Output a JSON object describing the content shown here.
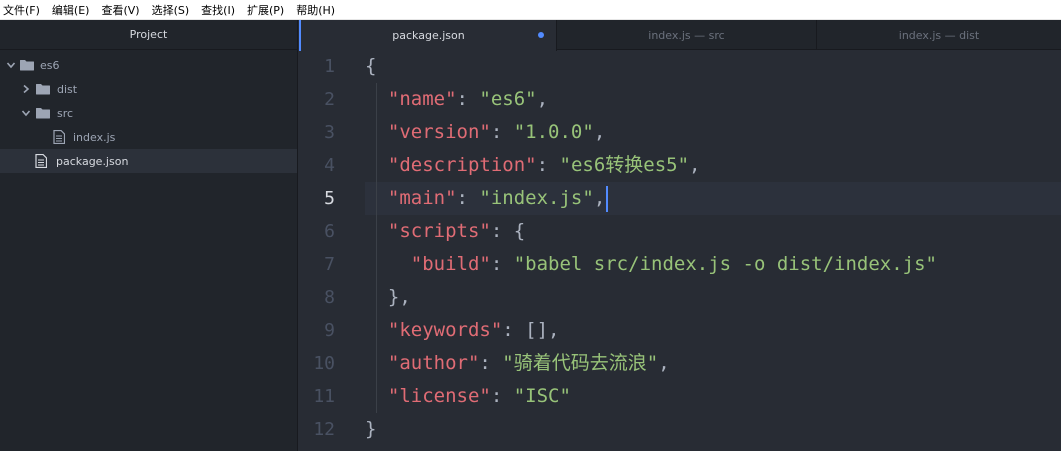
{
  "menubar": {
    "items": [
      {
        "label": "文件(F)"
      },
      {
        "label": "编辑(E)"
      },
      {
        "label": "查看(V)"
      },
      {
        "label": "选择(S)"
      },
      {
        "label": "查找(I)"
      },
      {
        "label": "扩展(P)"
      },
      {
        "label": "帮助(H)"
      }
    ]
  },
  "sidebar": {
    "title": "Project",
    "tree": {
      "root": {
        "label": "es6",
        "icon": "folder-open-icon"
      },
      "dist": {
        "label": "dist",
        "icon": "folder-icon"
      },
      "src": {
        "label": "src",
        "icon": "folder-open-icon"
      },
      "index": {
        "label": "index.js",
        "icon": "file-icon"
      },
      "package": {
        "label": "package.json",
        "icon": "file-icon"
      }
    }
  },
  "tabs": [
    {
      "label": "package.json",
      "active": true,
      "modified": true
    },
    {
      "label": "index.js — src",
      "active": false
    },
    {
      "label": "index.js — dist",
      "active": false
    }
  ],
  "editor": {
    "current_line": 5,
    "line_numbers": [
      "1",
      "2",
      "3",
      "4",
      "5",
      "6",
      "7",
      "8",
      "9",
      "10",
      "11",
      "12"
    ],
    "lines": [
      {
        "tokens": [
          [
            "p",
            "{"
          ]
        ]
      },
      {
        "tokens": [
          [
            "p",
            "  "
          ],
          [
            "k",
            "\"name\""
          ],
          [
            "p",
            ": "
          ],
          [
            "s",
            "\"es6\""
          ],
          [
            "p",
            ","
          ]
        ]
      },
      {
        "tokens": [
          [
            "p",
            "  "
          ],
          [
            "k",
            "\"version\""
          ],
          [
            "p",
            ": "
          ],
          [
            "s",
            "\"1.0.0\""
          ],
          [
            "p",
            ","
          ]
        ]
      },
      {
        "tokens": [
          [
            "p",
            "  "
          ],
          [
            "k",
            "\"description\""
          ],
          [
            "p",
            ": "
          ],
          [
            "s",
            "\"es6转换es5\""
          ],
          [
            "p",
            ","
          ]
        ]
      },
      {
        "tokens": [
          [
            "p",
            "  "
          ],
          [
            "k",
            "\"main\""
          ],
          [
            "p",
            ": "
          ],
          [
            "s",
            "\"index.js\""
          ],
          [
            "p",
            ","
          ]
        ]
      },
      {
        "tokens": [
          [
            "p",
            "  "
          ],
          [
            "k",
            "\"scripts\""
          ],
          [
            "p",
            ": {"
          ]
        ]
      },
      {
        "tokens": [
          [
            "p",
            "    "
          ],
          [
            "k",
            "\"build\""
          ],
          [
            "p",
            ": "
          ],
          [
            "s",
            "\"babel src/index.js -o dist/index.js\""
          ]
        ]
      },
      {
        "tokens": [
          [
            "p",
            "  },"
          ]
        ]
      },
      {
        "tokens": [
          [
            "p",
            "  "
          ],
          [
            "k",
            "\"keywords\""
          ],
          [
            "p",
            ": [],"
          ]
        ]
      },
      {
        "tokens": [
          [
            "p",
            "  "
          ],
          [
            "k",
            "\"author\""
          ],
          [
            "p",
            ": "
          ],
          [
            "s",
            "\"骑着代码去流浪\""
          ],
          [
            "p",
            ","
          ]
        ]
      },
      {
        "tokens": [
          [
            "p",
            "  "
          ],
          [
            "k",
            "\"license\""
          ],
          [
            "p",
            ": "
          ],
          [
            "s",
            "\"ISC\""
          ]
        ]
      },
      {
        "tokens": [
          [
            "p",
            "}"
          ]
        ]
      }
    ]
  },
  "colors": {
    "key": "#e06c75",
    "string": "#98c379",
    "punct": "#abb2bf",
    "accent": "#528bff",
    "background": "#282c34"
  }
}
